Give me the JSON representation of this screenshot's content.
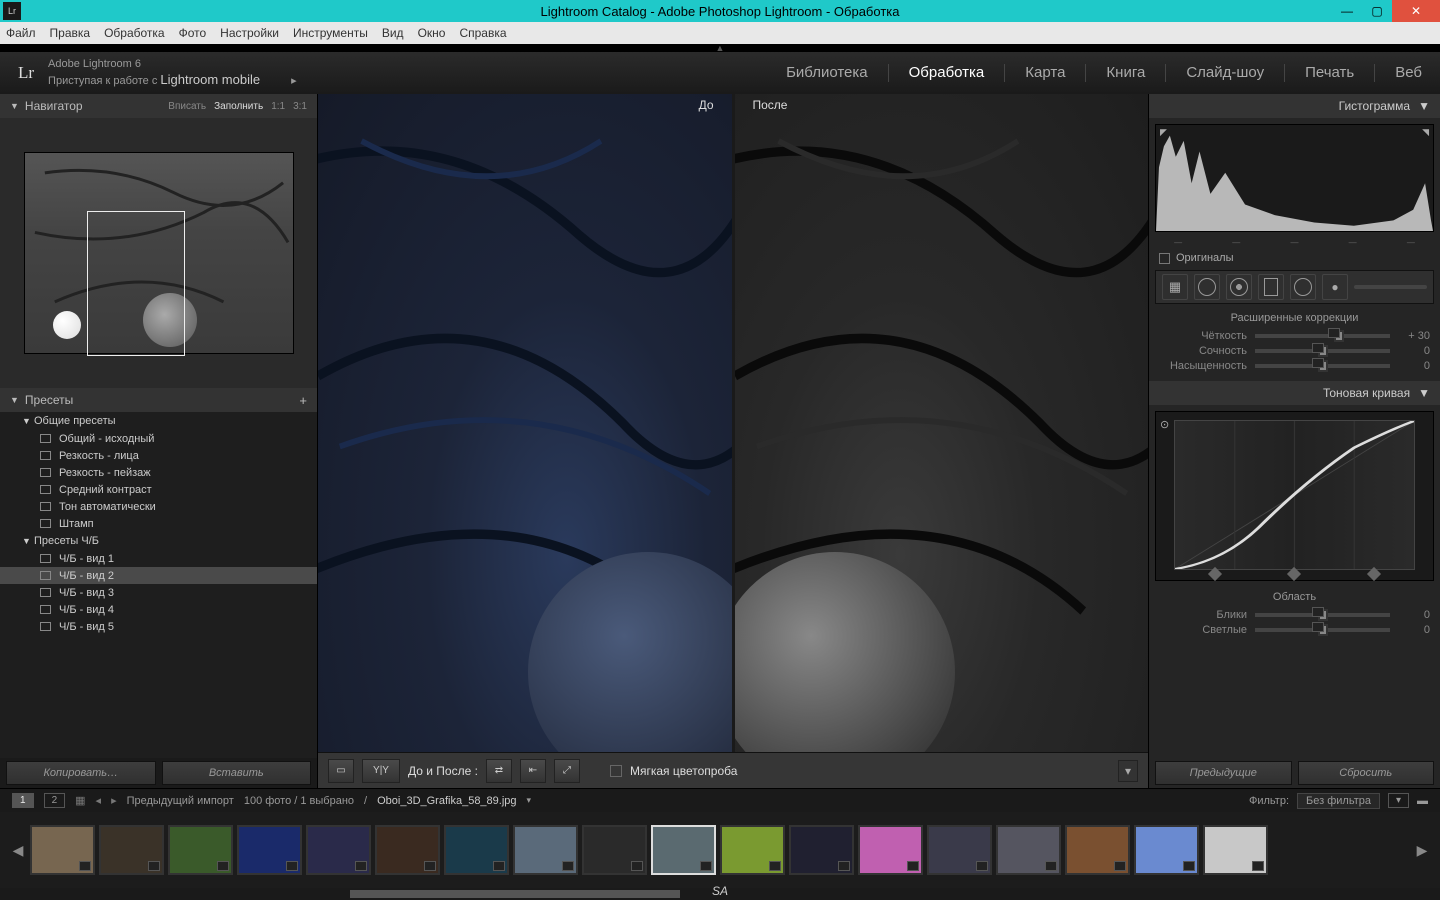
{
  "titlebar": {
    "icon": "Lr",
    "title": "Lightroom Catalog - Adobe Photoshop Lightroom - Обработка"
  },
  "menubar": [
    "Файл",
    "Правка",
    "Обработка",
    "Фото",
    "Настройки",
    "Инструменты",
    "Вид",
    "Окно",
    "Справка"
  ],
  "header": {
    "product": "Adobe Lightroom 6",
    "mobilePrefix": "Приступая к работе с ",
    "mobile": "Lightroom mobile",
    "modules": [
      "Библиотека",
      "Обработка",
      "Карта",
      "Книга",
      "Слайд-шоу",
      "Печать",
      "Веб"
    ],
    "active": "Обработка"
  },
  "navigator": {
    "title": "Навигатор",
    "zoom": [
      "Вписать",
      "Заполнить",
      "1:1",
      "3:1"
    ],
    "zoomActive": "Заполнить"
  },
  "presets": {
    "title": "Пресеты",
    "groups": [
      {
        "name": "Общие пресеты",
        "items": [
          "Общий - исходный",
          "Резкость - лица",
          "Резкость - пейзаж",
          "Средний контраст",
          "Тон автоматически",
          "Штамп"
        ]
      },
      {
        "name": "Пресеты Ч/Б",
        "items": [
          "Ч/Б - вид 1",
          "Ч/Б - вид 2",
          "Ч/Б - вид 3",
          "Ч/Б - вид 4",
          "Ч/Б - вид 5"
        ]
      }
    ],
    "selected": "Ч/Б - вид 2"
  },
  "leftButtons": {
    "copy": "Копировать…",
    "paste": "Вставить"
  },
  "compare": {
    "before": "До",
    "after": "После",
    "barLabel": "До и После :",
    "softproof": "Мягкая цветопроба"
  },
  "rightButtons": {
    "prev": "Предыдущие",
    "reset": "Сбросить"
  },
  "histogram": {
    "title": "Гистограмма",
    "originals": "Оригиналы"
  },
  "basic": {
    "title": "Расширенные коррекции",
    "rows": [
      {
        "label": "Чёткость",
        "value": "+ 30",
        "pos": 62
      },
      {
        "label": "Сочность",
        "value": "0",
        "pos": 50
      },
      {
        "label": "Насыщенность",
        "value": "0",
        "pos": 50
      }
    ]
  },
  "tone": {
    "title": "Тоновая кривая"
  },
  "region": {
    "title": "Область",
    "rows": [
      {
        "label": "Блики",
        "value": "0",
        "pos": 50
      },
      {
        "label": "Светлые",
        "value": "0",
        "pos": 50
      }
    ]
  },
  "filmstrip": {
    "mode1": "1",
    "mode2": "2",
    "prevImport": "Предыдущий импорт",
    "count": "100 фото  /  1 выбрано",
    "filename": "Oboi_3D_Grafika_58_89.jpg",
    "filterLabel": "Фильтр:",
    "filterValue": "Без фильтра",
    "thumbColors": [
      "#776650",
      "#3a3228",
      "#3a5a2a",
      "#1a2a6a",
      "#2a2a4a",
      "#3a2a20",
      "#1a3a4a",
      "#5a6a7a",
      "#2a2a2a",
      "#5a6a70",
      "#7a9a30",
      "#202030",
      "#c060b0",
      "#3a3a4a",
      "#555560",
      "#7a5030",
      "#6a8ad0",
      "#c8c8c8"
    ]
  },
  "watermark": "SA"
}
